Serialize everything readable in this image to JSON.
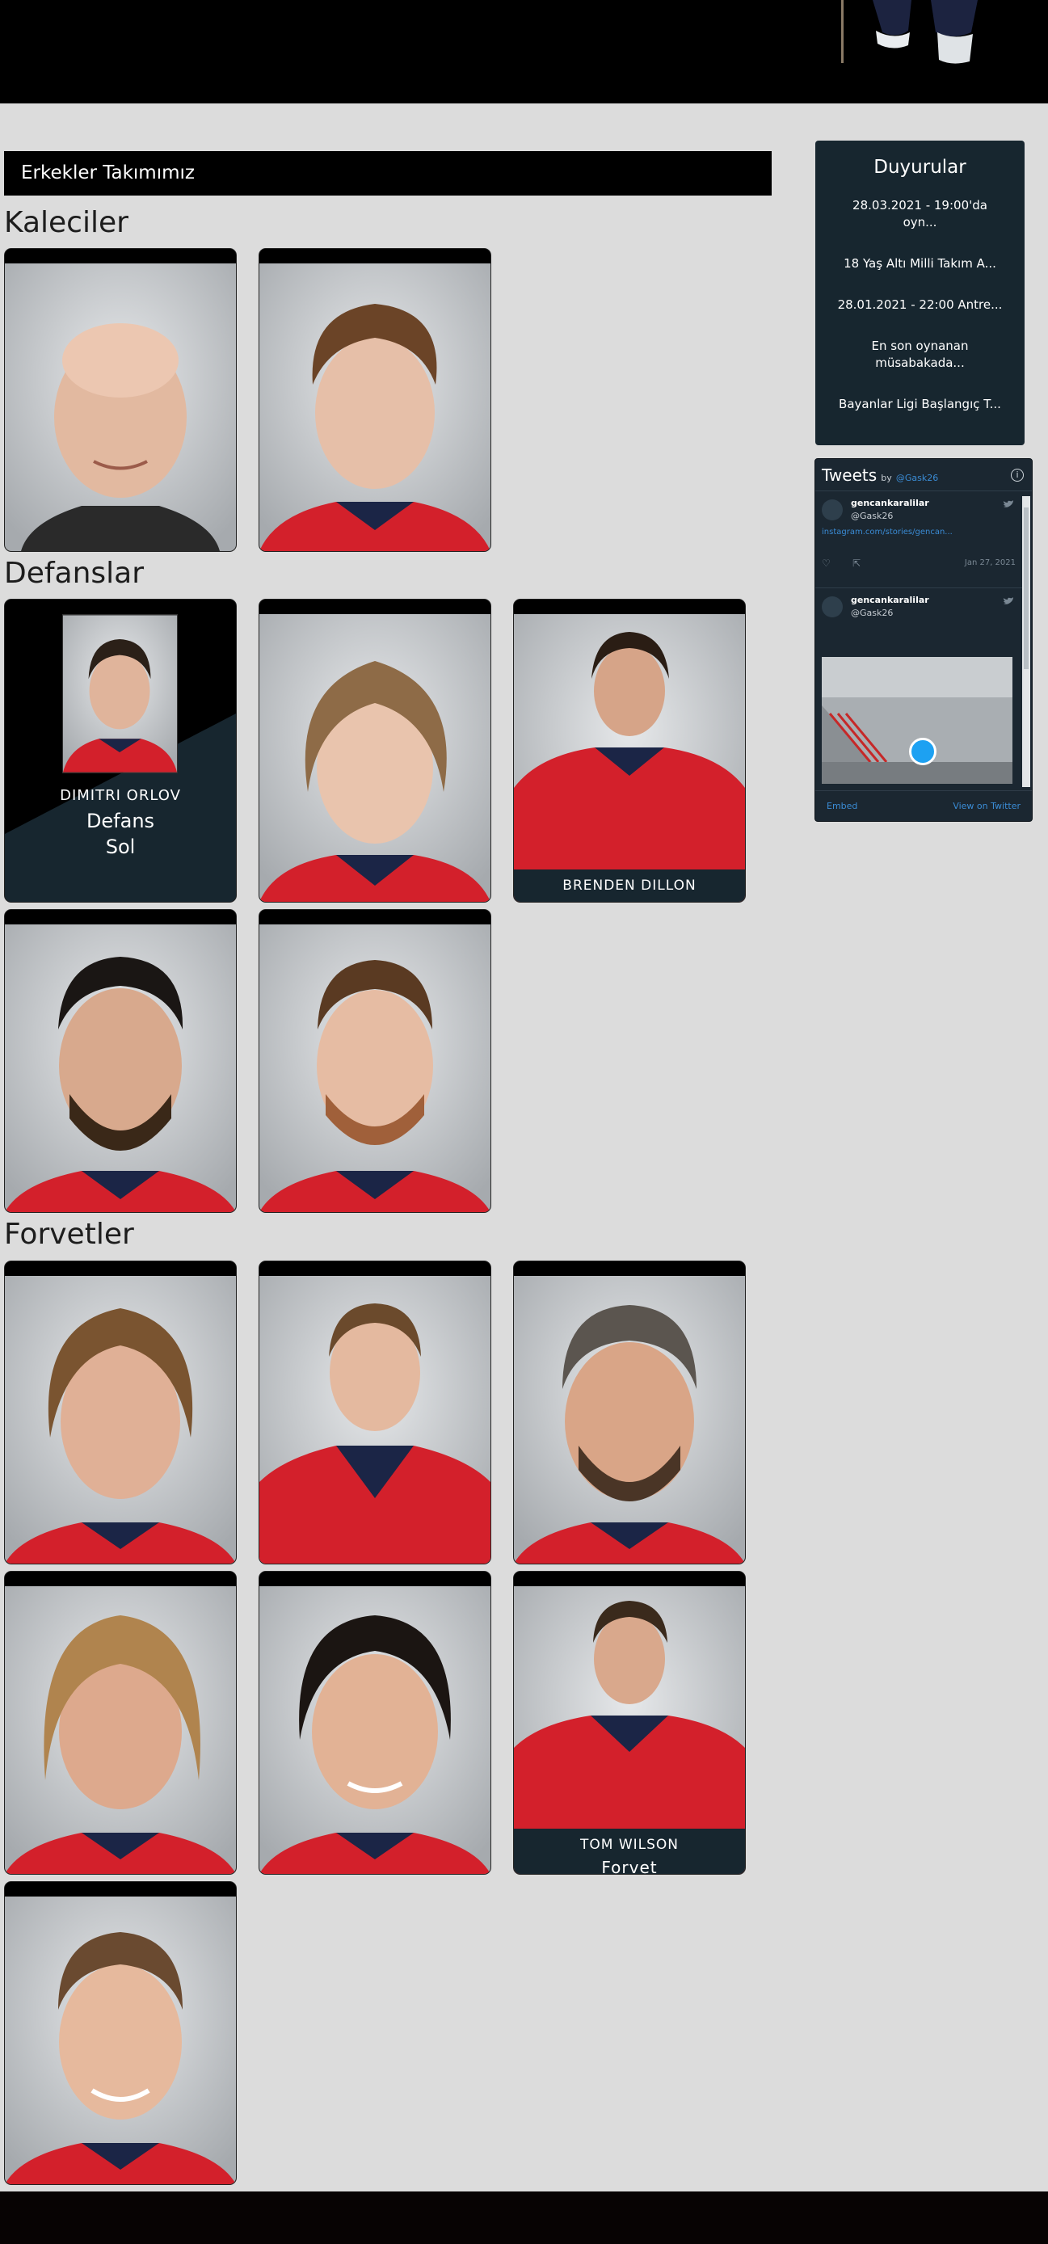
{
  "header": {
    "hero_image": "hockey-player-legs"
  },
  "team": {
    "title": "Erkekler Takımımız"
  },
  "sections": {
    "goalies": "Kaleciler",
    "defense": "Defanslar",
    "forwards": "Forvetler"
  },
  "players": {
    "orlov": {
      "name": "DIMITRI ORLOV",
      "position": "Defans",
      "side": "Sol"
    },
    "dillon": {
      "name": "BRENDEN DILLON"
    },
    "wilson": {
      "name": "TOM WILSON",
      "position": "Forvet"
    }
  },
  "announcements": {
    "title": "Duyurular",
    "items": [
      "28.03.2021 - 19:00'da oyn...",
      "18 Yaş Altı Milli Takım A...",
      "28.01.2021 - 22:00 Antre...",
      "En son oynanan müsabakada...",
      "Bayanlar Ligi Başlangıç T..."
    ]
  },
  "twitter": {
    "title": "Tweets",
    "by": "by",
    "handle_link": "@Gask26",
    "tweets": [
      {
        "name": "gencankaralilar",
        "handle": "@Gask26",
        "link": "instagram.com/stories/gencan...",
        "date": "Jan 27, 2021"
      },
      {
        "name": "gencankaralilar",
        "handle": "@Gask26"
      }
    ],
    "embed": "Embed",
    "view": "View on Twitter"
  },
  "colors": {
    "page_bg": "#dcdcdc",
    "card_caption": "#17262f",
    "jersey_red": "#d3202b",
    "jersey_navy": "#1b2546",
    "link": "#3a8bd4"
  }
}
